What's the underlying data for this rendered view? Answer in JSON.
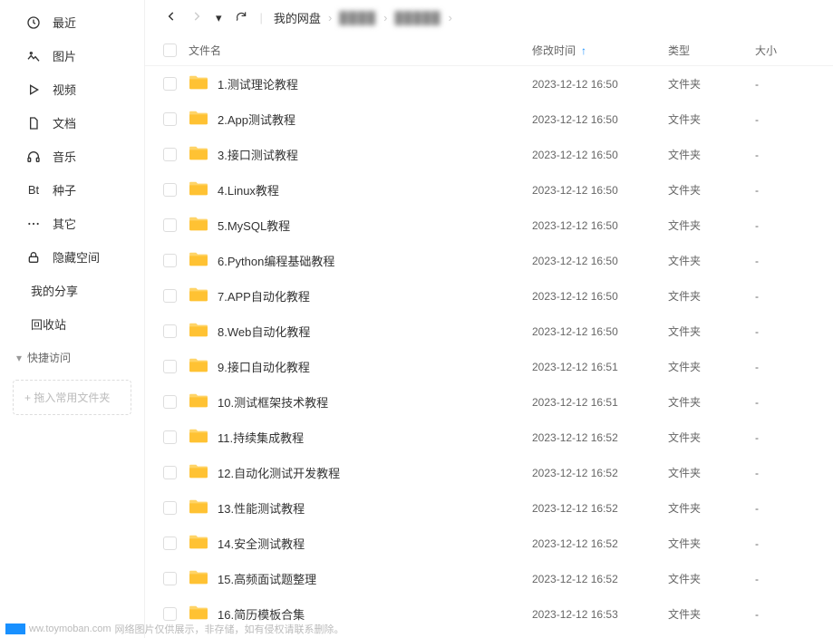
{
  "sidebar": {
    "items": [
      {
        "label": "最近"
      },
      {
        "label": "图片"
      },
      {
        "label": "视频"
      },
      {
        "label": "文档"
      },
      {
        "label": "音乐"
      },
      {
        "label": "种子",
        "iconText": "Bt"
      },
      {
        "label": "其它"
      },
      {
        "label": "隐藏空间"
      }
    ],
    "simple_items": [
      {
        "label": "我的分享"
      },
      {
        "label": "回收站"
      }
    ],
    "quick_access_label": "快捷访问",
    "drop_zone_text": "+ 拖入常用文件夹"
  },
  "breadcrumb": {
    "root": "我的网盘",
    "blur1": "████",
    "blur2": "█████"
  },
  "columns": {
    "name": "文件名",
    "date": "修改时间",
    "type": "类型",
    "size": "大小"
  },
  "folder_type_label": "文件夹",
  "size_placeholder": "-",
  "files": [
    {
      "name": "1.测试理论教程",
      "date": "2023-12-12 16:50"
    },
    {
      "name": "2.App测试教程",
      "date": "2023-12-12 16:50"
    },
    {
      "name": "3.接口测试教程",
      "date": "2023-12-12 16:50"
    },
    {
      "name": "4.Linux教程",
      "date": "2023-12-12 16:50"
    },
    {
      "name": "5.MySQL教程",
      "date": "2023-12-12 16:50"
    },
    {
      "name": "6.Python编程基础教程",
      "date": "2023-12-12 16:50"
    },
    {
      "name": "7.APP自动化教程",
      "date": "2023-12-12 16:50"
    },
    {
      "name": "8.Web自动化教程",
      "date": "2023-12-12 16:50"
    },
    {
      "name": "9.接口自动化教程",
      "date": "2023-12-12 16:51"
    },
    {
      "name": "10.测试框架技术教程",
      "date": "2023-12-12 16:51"
    },
    {
      "name": "11.持续集成教程",
      "date": "2023-12-12 16:52"
    },
    {
      "name": "12.自动化测试开发教程",
      "date": "2023-12-12 16:52"
    },
    {
      "name": "13.性能测试教程",
      "date": "2023-12-12 16:52"
    },
    {
      "name": "14.安全测试教程",
      "date": "2023-12-12 16:52"
    },
    {
      "name": "15.高频面试题整理",
      "date": "2023-12-12 16:52"
    },
    {
      "name": "16.简历模板合集",
      "date": "2023-12-12 16:53"
    }
  ],
  "footer": {
    "site": "ww.toymoban.com",
    "text": "网络图片仅供展示，非存储，如有侵权请联系删除。"
  }
}
